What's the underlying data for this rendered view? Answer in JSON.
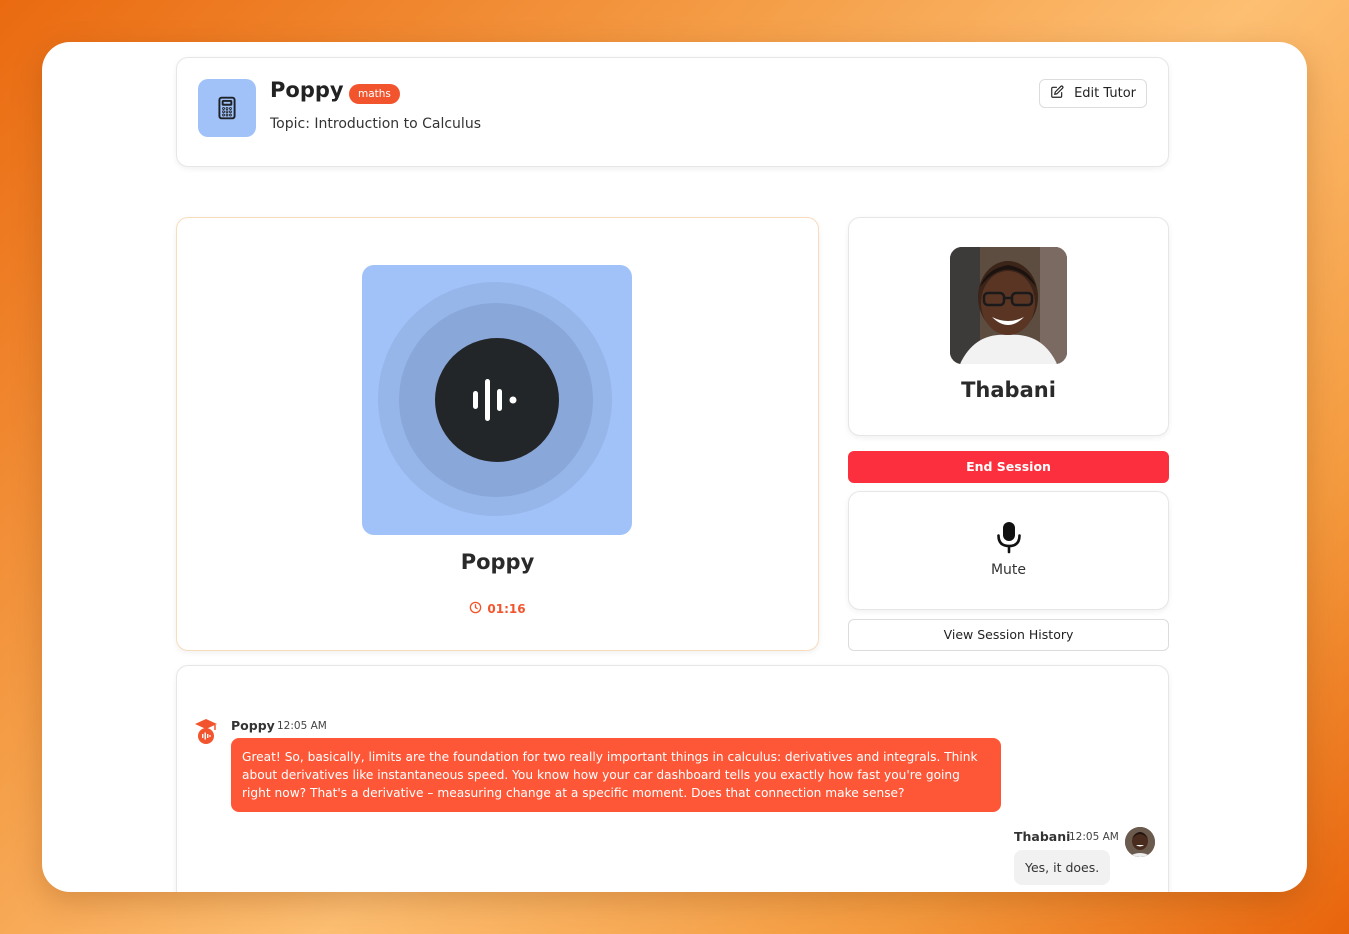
{
  "header": {
    "tutor_name": "Poppy",
    "subject_badge": "maths",
    "topic": "Topic: Introduction to Calculus",
    "edit_label": "Edit Tutor",
    "icon": "calculator-icon"
  },
  "voice": {
    "name": "Poppy",
    "timer": "01:16",
    "icon": "audio-waveform-icon"
  },
  "user": {
    "name": "Thabani"
  },
  "controls": {
    "end_session_label": "End Session",
    "mute_label": "Mute",
    "history_label": "View Session History"
  },
  "chat": {
    "messages": [
      {
        "sender": "Poppy",
        "time": "12:05 AM",
        "text": "Great! So, basically, limits are the foundation for two really important things in calculus: derivatives and integrals. Think about derivatives like instantaneous speed. You know how your car dashboard tells you exactly how fast you're going right now? That's a derivative – measuring change at a specific moment. Does that connection make sense?"
      },
      {
        "sender": "Thabani",
        "time": "12:05 AM",
        "text": "Yes, it does."
      }
    ]
  },
  "colors": {
    "accent": "#f2552e",
    "danger": "#fb2f3d",
    "tile": "#a1c2f8",
    "bot_bubble": "#fe5738"
  }
}
